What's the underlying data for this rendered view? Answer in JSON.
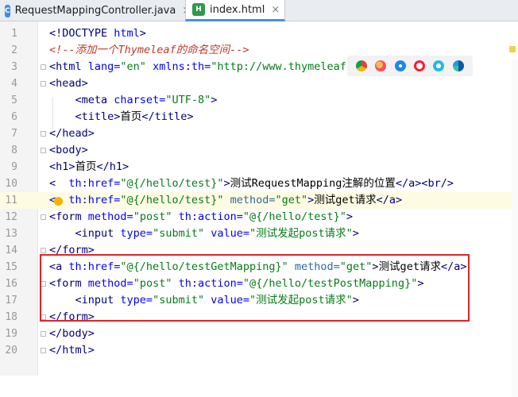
{
  "tabs": [
    {
      "label": "RequestMappingController.java",
      "icon": "java-class-icon",
      "active": false
    },
    {
      "label": "index.html",
      "icon": "html-file-icon",
      "active": true
    }
  ],
  "colors": {
    "tag": "#000080",
    "attribute": "#0000ff",
    "value": "#067d17",
    "comment": "#c0392b",
    "highlight_box": "#e0232a",
    "active_tab_underline": "#4b8fe0"
  },
  "browsers": [
    "chrome-icon",
    "firefox-icon",
    "safari-icon",
    "opera-icon",
    "ie-icon",
    "edge-icon"
  ],
  "lines": [
    {
      "n": "1",
      "parts": [
        [
          "tag",
          "<!DOCTYPE "
        ],
        [
          "attr",
          "html"
        ],
        [
          "tag",
          ">"
        ]
      ]
    },
    {
      "n": "2",
      "parts": [
        [
          "cmt",
          "<!--添加一个Thymeleaf的命名空间-->"
        ]
      ]
    },
    {
      "n": "3",
      "parts": [
        [
          "tag",
          "<html "
        ],
        [
          "attr",
          "lang="
        ],
        [
          "val",
          "\"en\" "
        ],
        [
          "attr",
          "xmlns:th="
        ],
        [
          "val",
          "\"http://www.thymeleaf."
        ]
      ]
    },
    {
      "n": "4",
      "parts": [
        [
          "tag",
          "<head>"
        ]
      ]
    },
    {
      "n": "5",
      "parts": [
        [
          "txt",
          "    "
        ],
        [
          "tag",
          "<meta "
        ],
        [
          "attr",
          "charset="
        ],
        [
          "val",
          "\"UTF-8\""
        ],
        [
          "tag",
          ">"
        ]
      ]
    },
    {
      "n": "6",
      "parts": [
        [
          "txt",
          "    "
        ],
        [
          "tag",
          "<title>"
        ],
        [
          "txt",
          "首页"
        ],
        [
          "tag",
          "</title>"
        ]
      ]
    },
    {
      "n": "7",
      "parts": [
        [
          "tag",
          "</head>"
        ]
      ]
    },
    {
      "n": "8",
      "parts": [
        [
          "tag",
          "<body>"
        ]
      ]
    },
    {
      "n": "9",
      "parts": [
        [
          "tag",
          "<h1>"
        ],
        [
          "txt",
          "首页"
        ],
        [
          "tag",
          "</h1>"
        ]
      ]
    },
    {
      "n": "10",
      "parts": [
        [
          "tag",
          "<  "
        ],
        [
          "attr",
          "th:href="
        ],
        [
          "val",
          "\"@{/hello/test}\""
        ],
        [
          "tag",
          ">"
        ],
        [
          "txt",
          "测试RequestMapping注解的位置"
        ],
        [
          "tag",
          "</a><br/>"
        ]
      ]
    },
    {
      "n": "11",
      "parts": [
        [
          "tag",
          "<a "
        ],
        [
          "attr",
          "th:href="
        ],
        [
          "val",
          "\"@{/hello/test}\" "
        ],
        [
          "thattr",
          "method="
        ],
        [
          "val",
          "\"get\""
        ],
        [
          "tag",
          ">"
        ],
        [
          "txt",
          "测试get请求"
        ],
        [
          "tag",
          "</a>"
        ]
      ]
    },
    {
      "n": "12",
      "parts": [
        [
          "tag",
          "<form "
        ],
        [
          "attr",
          "method="
        ],
        [
          "val",
          "\"post\" "
        ],
        [
          "attr",
          "th:action="
        ],
        [
          "val",
          "\"@{/hello/test}\""
        ],
        [
          "tag",
          ">"
        ]
      ]
    },
    {
      "n": "13",
      "parts": [
        [
          "txt",
          "    "
        ],
        [
          "tag",
          "<input "
        ],
        [
          "attr",
          "type="
        ],
        [
          "val",
          "\"submit\" "
        ],
        [
          "attr",
          "value="
        ],
        [
          "val",
          "\"测试发起post请求\""
        ],
        [
          "tag",
          ">"
        ]
      ]
    },
    {
      "n": "14",
      "parts": [
        [
          "tag",
          "</form>"
        ]
      ]
    },
    {
      "n": "15",
      "parts": [
        [
          "tag",
          "<a "
        ],
        [
          "attr",
          "th:href="
        ],
        [
          "val",
          "\"@{/hello/testGetMapping}\" "
        ],
        [
          "thattr",
          "method="
        ],
        [
          "val",
          "\"get\""
        ],
        [
          "tag",
          ">"
        ],
        [
          "txt",
          "测试get请求"
        ],
        [
          "tag",
          "</a>"
        ]
      ]
    },
    {
      "n": "16",
      "parts": [
        [
          "tag",
          "<form "
        ],
        [
          "attr",
          "method="
        ],
        [
          "val",
          "\"post\" "
        ],
        [
          "attr",
          "th:action="
        ],
        [
          "val",
          "\"@{/hello/testPostMapping}\""
        ],
        [
          "tag",
          ">"
        ]
      ]
    },
    {
      "n": "17",
      "parts": [
        [
          "txt",
          "    "
        ],
        [
          "tag",
          "<input "
        ],
        [
          "attr",
          "type="
        ],
        [
          "val",
          "\"submit\" "
        ],
        [
          "attr",
          "value="
        ],
        [
          "val",
          "\"测试发起post请求\""
        ],
        [
          "tag",
          ">"
        ]
      ]
    },
    {
      "n": "18",
      "parts": [
        [
          "tag",
          "</form>"
        ]
      ]
    },
    {
      "n": "19",
      "parts": [
        [
          "tag",
          "</body>"
        ]
      ]
    },
    {
      "n": "20",
      "parts": [
        [
          "tag",
          "</html>"
        ]
      ]
    }
  ]
}
